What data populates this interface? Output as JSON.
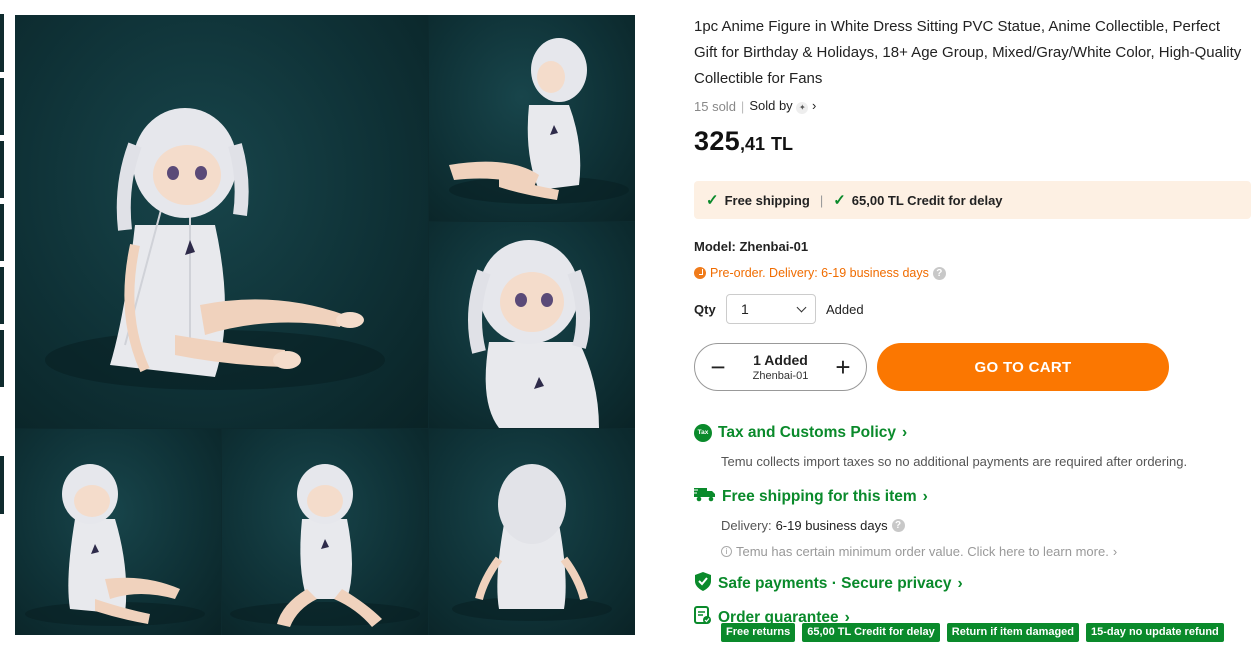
{
  "product": {
    "title": "1pc Anime Figure in White Dress Sitting PVC Statue, Anime Collectible, Perfect Gift for Birthday & Holidays, 18+ Age Group, Mixed/Gray/White Color, High-Quality Collectible for Fans",
    "sold": "15 sold",
    "sold_by_label": "Sold by",
    "price_int": "325",
    "price_dec": ",41",
    "currency": "TL"
  },
  "shipping_bar": {
    "free_shipping": "Free shipping",
    "credit": "65,00 TL Credit for delay"
  },
  "model": "Model: Zhenbai-01",
  "preorder": "Pre-order. Delivery: 6-19 business days",
  "qty": {
    "label": "Qty",
    "value": "1",
    "status": "Added"
  },
  "stepper": {
    "value": "1 Added",
    "model": "Zhenbai-01",
    "minus": "−",
    "plus": "+"
  },
  "cart_button": "GO TO CART",
  "tax": {
    "icon_text": "Tax",
    "title": "Tax and Customs Policy",
    "text": "Temu collects import taxes so no additional payments are required after ordering."
  },
  "free_shipping": {
    "title": "Free shipping for this item",
    "delivery_label": "Delivery:",
    "delivery_value": "6-19 business days",
    "note": "Temu has certain minimum order value. Click here to learn more."
  },
  "safe_payments": {
    "title": "Safe payments · Secure privacy"
  },
  "order_guarantee": {
    "title": "Order guarantee",
    "badges": [
      "Free returns",
      "65,00 TL Credit for delay",
      "Return if item damaged",
      "15-day no update refund"
    ]
  },
  "colors": {
    "accent_orange": "#fb7701",
    "green": "#0a8a2b",
    "ship_bar_bg": "#fdf0e3"
  }
}
